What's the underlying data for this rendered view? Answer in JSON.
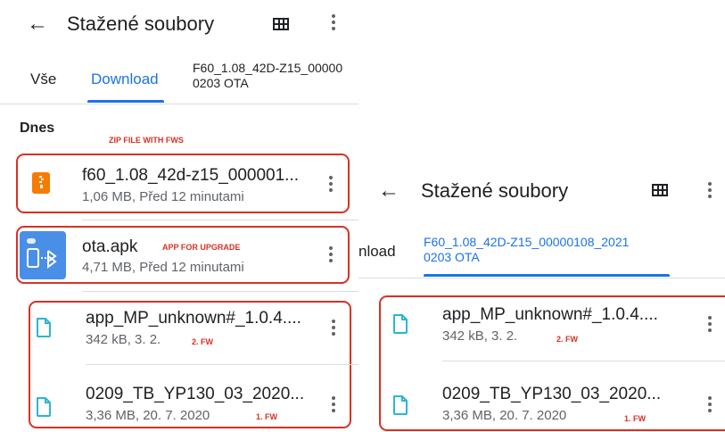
{
  "left": {
    "title": "Stažené soubory",
    "tabs": [
      {
        "label": "Vše"
      },
      {
        "label": "Download"
      },
      {
        "label_line1": "F60_1.08_42D-Z15_00000",
        "label_line2": "0203 OTA"
      }
    ],
    "section_header": "Dnes",
    "files": [
      {
        "name": "f60_1.08_42d-z15_000001...",
        "meta": "1,06 MB, Před 12 minutami",
        "icon": "zip-archive-icon"
      },
      {
        "name": "ota.apk",
        "meta": "4,71 MB, Před 12 minutami",
        "icon": "apk-bluetooth-icon"
      },
      {
        "name": "app_MP_unknown#_1.0.4....",
        "meta": "342 kB, 3. 2.",
        "icon": "document-icon"
      },
      {
        "name": "0209_TB_YP130_03_2020...",
        "meta": "3,36 MB, 20. 7. 2020",
        "icon": "document-icon"
      }
    ],
    "annotations": {
      "zip": "ZIP FILE WITH FWS",
      "apk": "APP FOR UPGRADE",
      "fw2": "2. FW",
      "fw1": "1. FW"
    }
  },
  "right": {
    "title": "Stažené soubory",
    "tabs": [
      {
        "label": "nload"
      },
      {
        "label_line1": "F60_1.08_42D-Z15_00000108_2021",
        "label_line2": "0203 OTA"
      }
    ],
    "files": [
      {
        "name": "app_MP_unknown#_1.0.4....",
        "meta": "342 kB, 3. 2.",
        "icon": "document-icon"
      },
      {
        "name": "0209_TB_YP130_03_2020...",
        "meta": "3,36 MB, 20. 7. 2020",
        "icon": "document-icon"
      }
    ],
    "annotations": {
      "fw2": "2. FW",
      "fw1": "1. FW"
    }
  },
  "colors": {
    "accent": "#1a73e8",
    "annotation_red": "#d93025",
    "zip_orange": "#f57c00",
    "apk_blue": "#4a8fe7",
    "doc_cyan": "#29b6d6"
  }
}
